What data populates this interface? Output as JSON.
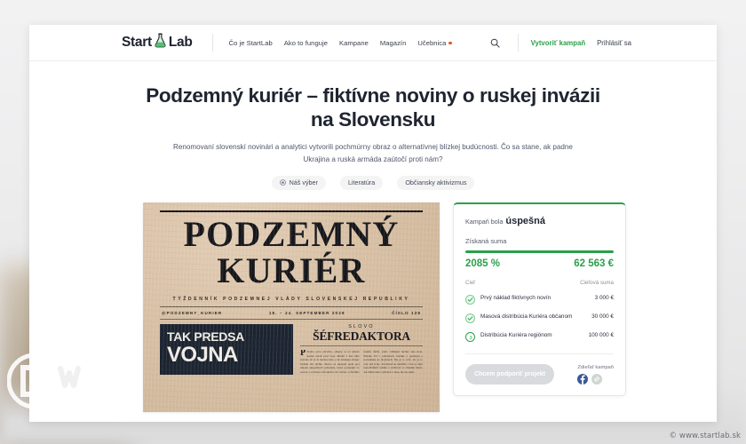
{
  "backdrop": {
    "logo_name": "dw-logo",
    "watermark": "© www.startlab.sk"
  },
  "header": {
    "brand_left": "Start",
    "brand_right": "Lab",
    "brand_icon": "flask-icon",
    "nav": [
      {
        "label": "Čo je StartLab",
        "dot": false
      },
      {
        "label": "Ako to funguje",
        "dot": false
      },
      {
        "label": "Kampane",
        "dot": false
      },
      {
        "label": "Magazín",
        "dot": false
      },
      {
        "label": "Učebnica",
        "dot": true
      }
    ],
    "search_icon": "search-icon",
    "cta_primary": "Vytvoriť kampaň",
    "cta_secondary": "Prihlásiť sa"
  },
  "hero": {
    "title": "Podzemný kuriér – fiktívne noviny o ruskej invázii na Slovensku",
    "lead": "Renomovaní slovenskí novinári a analytici vytvorili pochmúrny obraz o alternatívnej blízkej budúcnosti. Čo sa stane, ak padne Ukrajina a ruská armáda zaútočí proti nám?",
    "tags": [
      {
        "label": "Náš výber",
        "icon": "star-badge-icon"
      },
      {
        "label": "Literatúra",
        "icon": ""
      },
      {
        "label": "Občiansky aktivizmus",
        "icon": ""
      }
    ]
  },
  "newspaper": {
    "masthead_line1": "PODZEMNÝ",
    "masthead_line2": "KURIÉR",
    "subtitle": "TÝŽDENNÍK PODZEMNEJ VLÁDY SLOVENSKEJ REPUBLIKY",
    "handle": "@PODZEMNY_KURIER",
    "date": "18. – 24. SEPTEMBER 2028",
    "issue": "ČÍSLO 139",
    "headline_line1": "TAK PREDSA",
    "headline_line2": "VOJNA",
    "editorial_kicker": "SLOVO",
    "editorial_title": "ŠÉFREDAKTORA",
    "editorial_body": "Prešla sotva päťačka, odkedy sa na našom území začali prvé boje. Mnohí z nás stále neveria, že sa to naozaj stalo, a že stratégia obrany zlyhala tak rýchlo. Mesto za mestom padá pod tlakom okupačných jednotiek, ktoré postupujú zo severu a východu. Informácie sú vzácne a oficiálne kanály mlčia, preto vznikajú noviny ako tieto. Píšeme ich v pivniciach, tlačíme v garážach a rozvážame na bicykloch. Nie je to veľa, ale je to viac než ticho. Povinnosťou každého z nás je dnes nepodľahnúť panike a zachovať si chladnú hlavu. Ak držíte tento výtlačok v ruke, nie ste sami."
  },
  "campaign": {
    "status_prefix": "Kampaň bola",
    "status_value": "úspešná",
    "raised_label": "Získaná suma",
    "percent": "2085 %",
    "amount": "62 563 €",
    "goals_header_left": "Cieľ",
    "goals_header_right": "Cieľová suma",
    "goals": [
      {
        "name": "Prvý náklad fiktívnych novín",
        "amount": "3 000 €",
        "state": "done",
        "icon": "check-icon"
      },
      {
        "name": "Masová distribúcia Kuriéra občanom",
        "amount": "30 000 €",
        "state": "done",
        "icon": "check-icon"
      },
      {
        "name": "Distribúcia Kuriéra regiónom",
        "amount": "100 000 €",
        "state": "pending",
        "icon": "step-three-icon"
      }
    ],
    "support_button": "Chcem podporiť projekt",
    "share_label": "Zdieľať kampaň",
    "share_icons": [
      {
        "name": "facebook-icon"
      },
      {
        "name": "link-icon"
      }
    ]
  }
}
